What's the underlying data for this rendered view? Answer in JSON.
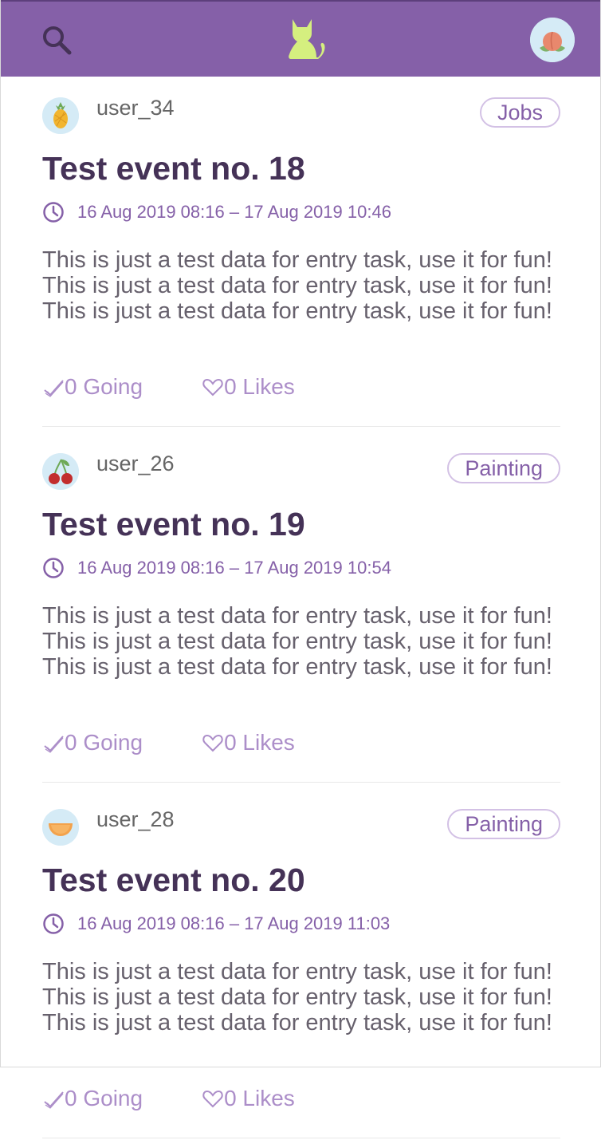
{
  "header": {
    "search_icon": "search-icon",
    "logo_icon": "cat-logo-icon",
    "avatar_icon": "peach-avatar-icon"
  },
  "colors": {
    "header_bg": "#8560a8",
    "logo": "#d5ef7f",
    "title": "#453257",
    "accent": "#8560a8",
    "stat": "#ac8ec9",
    "tag_border": "#d3c1e5",
    "body_text": "#67616d"
  },
  "events": [
    {
      "username": "user_34",
      "avatar": "pineapple-avatar-icon",
      "channel": "Jobs",
      "title": "Test event no. 18",
      "time": "16 Aug 2019 08:16 – 17 Aug 2019 10:46",
      "description": "This is just a test data for entry task, use it for fun! This is just a test data for entry task, use it for fun! This is just a test data for entry task, use it for fun!",
      "going": "0 Going",
      "likes": "0 Likes"
    },
    {
      "username": "user_26",
      "avatar": "cherry-avatar-icon",
      "channel": "Painting",
      "title": "Test event no. 19",
      "time": "16 Aug 2019 08:16 – 17 Aug 2019 10:54",
      "description": "This is just a test data for entry task, use it for fun! This is just a test data for entry task, use it for fun! This is just a test data for entry task, use it for fun!",
      "going": "0 Going",
      "likes": "0 Likes"
    },
    {
      "username": "user_28",
      "avatar": "orange-slice-avatar-icon",
      "channel": "Painting",
      "title": "Test event no. 20",
      "time": "16 Aug 2019 08:16 – 17 Aug 2019 11:03",
      "description": "This is just a test data for entry task, use it for fun! This is just a test data for entry task, use it for fun! This is just a test data for entry task, use it for fun!",
      "going": "0 Going",
      "likes": "0 Likes"
    }
  ]
}
